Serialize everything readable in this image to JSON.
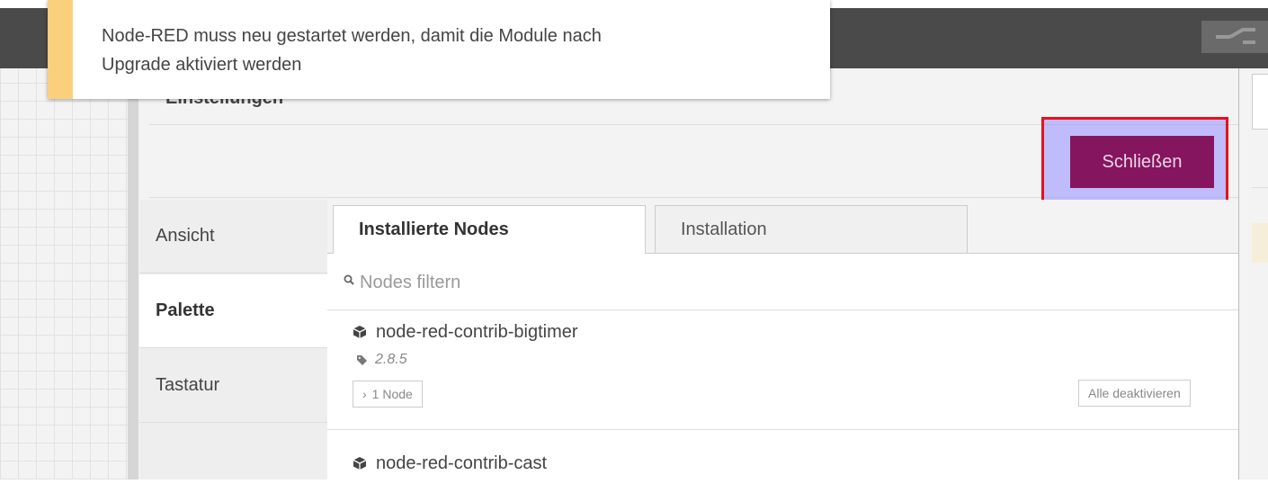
{
  "notification": {
    "line1": "Node-RED muss neu gestartet werden, damit die Module nach",
    "line2": "Upgrade aktiviert werden"
  },
  "dialog": {
    "title": "Einstellungen",
    "close_label": "Schließen"
  },
  "nav": {
    "items": [
      {
        "label": "Ansicht"
      },
      {
        "label": "Palette"
      },
      {
        "label": "Tastatur"
      }
    ],
    "active": "Palette"
  },
  "tabs": [
    {
      "label": "Installierte Nodes"
    },
    {
      "label": "Installation"
    }
  ],
  "filter": {
    "placeholder": "Nodes filtern"
  },
  "nodes": [
    {
      "name": "node-red-contrib-bigtimer",
      "version": "2.8.5",
      "count_label": "1 Node",
      "disable_label": "Alle deaktivieren"
    },
    {
      "name": "node-red-contrib-cast"
    }
  ],
  "colors": {
    "accent": "#85155e",
    "warning": "#fbd07d",
    "highlight_border": "#e8101b"
  }
}
